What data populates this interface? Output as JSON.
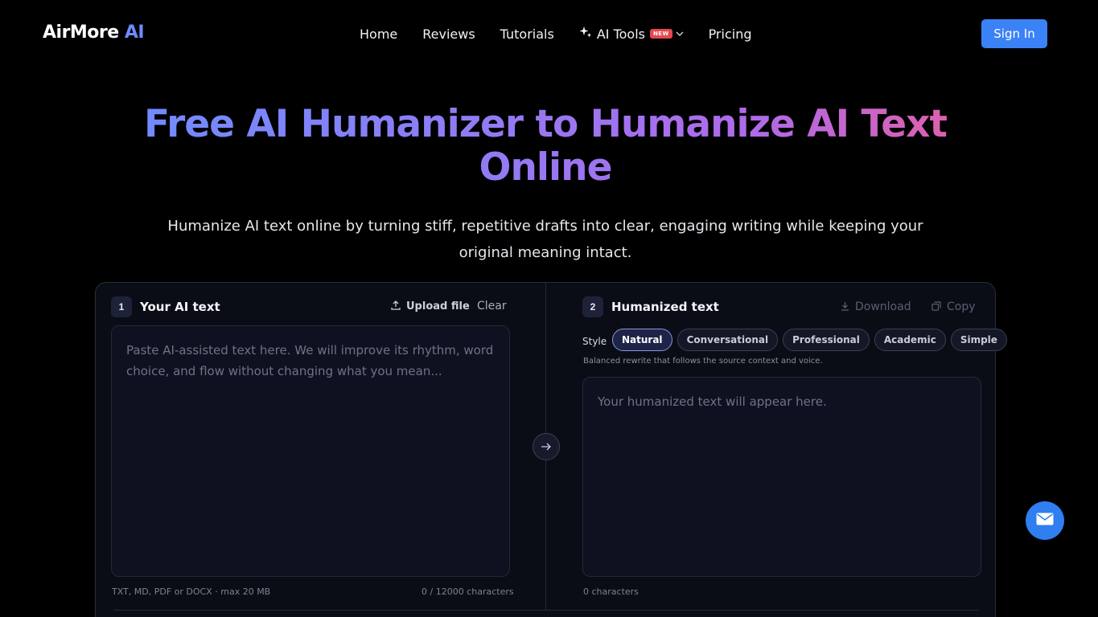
{
  "header": {
    "logo_main": "AirMore",
    "logo_accent": "AI",
    "nav": [
      {
        "label": "Home"
      },
      {
        "label": "Reviews"
      },
      {
        "label": "Tutorials"
      },
      {
        "label": "AI Tools",
        "badge": "NEW"
      },
      {
        "label": "Pricing"
      }
    ],
    "signin_label": "Sign In"
  },
  "hero": {
    "title_line1": "Free AI Humanizer to Humanize AI Text",
    "title_line2": "Online",
    "subtitle_line1": "Humanize AI text online by turning stiff, repetitive drafts into clear, engaging writing while keeping your",
    "subtitle_line2": "original meaning intact."
  },
  "input_pane": {
    "step": "1",
    "title": "Your AI text",
    "upload_label": "Upload file",
    "clear_label": "Clear",
    "placeholder": "Paste AI-assisted text here. We will improve its rhythm, word choice, and flow without changing what you mean...",
    "formats": "TXT, MD, PDF or DOCX · max 20 MB",
    "char_count": "0 / 12000 characters"
  },
  "output_pane": {
    "step": "2",
    "title": "Humanized text",
    "download_label": "Download",
    "copy_label": "Copy",
    "style_label": "Style",
    "styles": [
      "Natural",
      "Conversational",
      "Professional",
      "Academic",
      "Simple"
    ],
    "active_style": "Natural",
    "style_description": "Balanced rewrite that follows the source context and voice.",
    "placeholder": "Your humanized text will appear here.",
    "char_count": "0 characters"
  },
  "colors": {
    "background": "#000000",
    "accent_blue": "#3b82f6",
    "gradient_start": "#6f8cff",
    "gradient_end": "#e25fa8",
    "badge_red": "#e5484d"
  },
  "icons": {
    "ai_tools": "sparkle-icon",
    "upload": "upload-icon",
    "download": "download-icon",
    "copy": "copy-icon",
    "convert": "arrow-right-icon",
    "contact": "mail-icon"
  }
}
